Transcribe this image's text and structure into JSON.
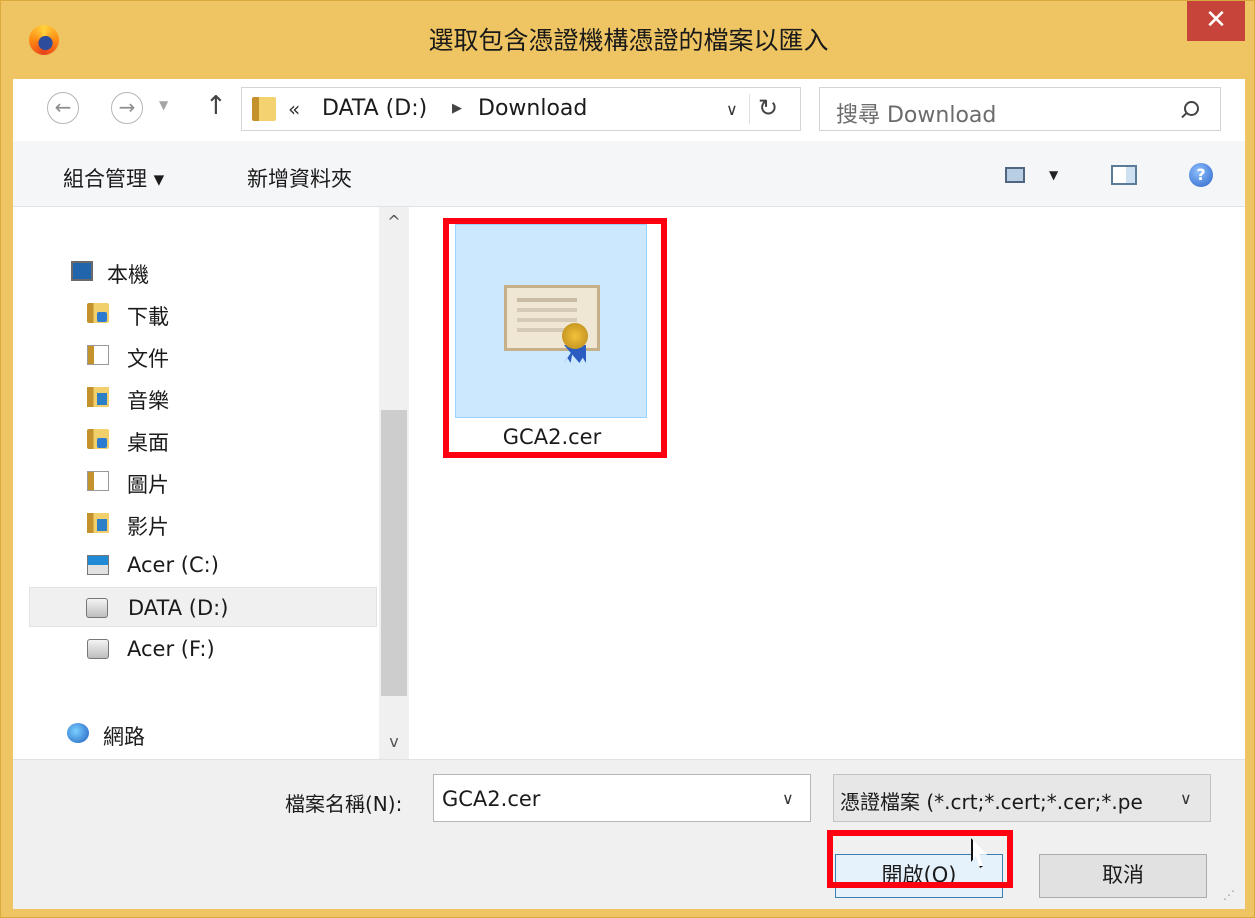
{
  "window": {
    "title": "選取包含憑證機構憑證的檔案以匯入",
    "close_glyph": "✕"
  },
  "nav": {
    "back_glyph": "←",
    "forward_glyph": "→",
    "up_glyph": "↑",
    "path_prefix": "«",
    "path": [
      "DATA (D:)",
      "Download"
    ],
    "refresh_glyph": "↻",
    "search_placeholder": "搜尋 Download"
  },
  "toolbar": {
    "organize_label": "組合管理 ▾",
    "new_folder_label": "新增資料夾",
    "help_glyph": "?"
  },
  "sidebar": {
    "items": [
      {
        "label": "本機",
        "icon": "computer-icon"
      },
      {
        "label": "下載",
        "icon": "downloads-folder-icon"
      },
      {
        "label": "文件",
        "icon": "documents-folder-icon"
      },
      {
        "label": "音樂",
        "icon": "music-folder-icon"
      },
      {
        "label": "桌面",
        "icon": "desktop-folder-icon"
      },
      {
        "label": "圖片",
        "icon": "pictures-folder-icon"
      },
      {
        "label": "影片",
        "icon": "videos-folder-icon"
      },
      {
        "label": "Acer (C:)",
        "icon": "windows-drive-icon"
      },
      {
        "label": "DATA (D:)",
        "icon": "drive-icon",
        "selected": true
      },
      {
        "label": "Acer (F:)",
        "icon": "drive-icon"
      },
      {
        "label": "網路",
        "icon": "network-icon"
      }
    ]
  },
  "files": [
    {
      "name": "GCA2.cer",
      "icon": "certificate-icon",
      "selected": true
    }
  ],
  "footer": {
    "filename_label": "檔案名稱(N):",
    "filename_value": "GCA2.cer",
    "filetype_value": "憑證檔案 (*.crt;*.cert;*.cer;*.pe",
    "open_label": "開啟(O)",
    "cancel_label": "取消"
  },
  "colors": {
    "frame": "#efc563",
    "close": "#c7443a",
    "selection": "#cce8ff",
    "highlight": "#ff0010"
  }
}
